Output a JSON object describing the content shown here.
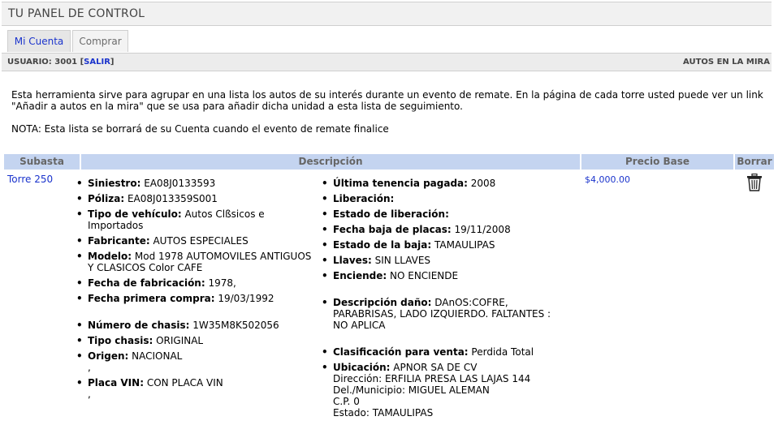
{
  "header": {
    "title": "TU PANEL DE CONTROL"
  },
  "tabs": [
    {
      "label": "Mi Cuenta"
    },
    {
      "label": "Comprar"
    }
  ],
  "userbar": {
    "user_label": "USUARIO: 3001 [",
    "logout": "SALIR",
    "close": "]",
    "section": "AUTOS EN LA MIRA"
  },
  "intro": {
    "p1": "Esta herramienta sirve para agrupar en una lista los autos de su interés durante un evento de remate. En la página de cada torre usted puede ver un link \"Añadir a autos en la mira\" que se usa para añadir dicha unidad a esta lista de seguimiento.",
    "p2": "NOTA: Esta lista se borrará de su Cuenta cuando el evento de remate finalice"
  },
  "table": {
    "headers": {
      "subasta": "Subasta",
      "descripcion": "Descripción",
      "precio": "Precio Base",
      "borrar": "Borrar"
    },
    "row": {
      "subasta": "Torre 250",
      "precio": "$4,000.00",
      "col1": [
        {
          "label": "Siniestro:",
          "value": " EA08J0133593"
        },
        {
          "label": "Póliza:",
          "value": " EA08J013359S001"
        },
        {
          "label": "Tipo de vehículo:",
          "value": " Autos Clßsicos e Importados"
        },
        {
          "label": "Fabricante:",
          "value": " AUTOS ESPECIALES"
        },
        {
          "label": "Modelo:",
          "value": " Mod 1978 AUTOMOVILES ANTIGUOS Y CLASICOS Color CAFE"
        },
        {
          "label": "Fecha de fabricación:",
          "value": " 1978,"
        },
        {
          "label": "Fecha primera compra:",
          "value": " 19/03/1992"
        },
        {
          "label": "Número de chasis:",
          "value": " 1W35M8K502056"
        },
        {
          "label": "Tipo chasis:",
          "value": " ORIGINAL"
        },
        {
          "label": "Origen:",
          "value": " NACIONAL",
          "after": ","
        },
        {
          "label": "Placa VIN:",
          "value": " CON PLACA VIN",
          "after": ","
        }
      ],
      "col2": [
        {
          "label": "Última tenencia pagada:",
          "value": " 2008"
        },
        {
          "label": "Liberación:",
          "value": ""
        },
        {
          "label": "Estado de liberación:",
          "value": ""
        },
        {
          "label": "Fecha baja de placas:",
          "value": " 19/11/2008"
        },
        {
          "label": "Estado de la baja:",
          "value": " TAMAULIPAS"
        },
        {
          "label": "Llaves:",
          "value": " SIN LLAVES"
        },
        {
          "label": "Enciende:",
          "value": " NO ENCIENDE"
        },
        {
          "label": "Descripción daño:",
          "value": " DAnOS:COFRE, PARABRISAS, LADO IZQUIERDO. FALTANTES : NO APLICA"
        },
        {
          "label": "Clasificación para venta:",
          "value": " Perdida Total"
        },
        {
          "label": "Ubicación:",
          "value": " APNOR SA DE CV",
          "extra": [
            "Dirección: ERFILIA PRESA LAS LAJAS 144",
            "Del./Municipio: MIGUEL ALEMAN",
            "C.P. 0",
            "Estado: TAMAULIPAS"
          ]
        }
      ]
    }
  }
}
